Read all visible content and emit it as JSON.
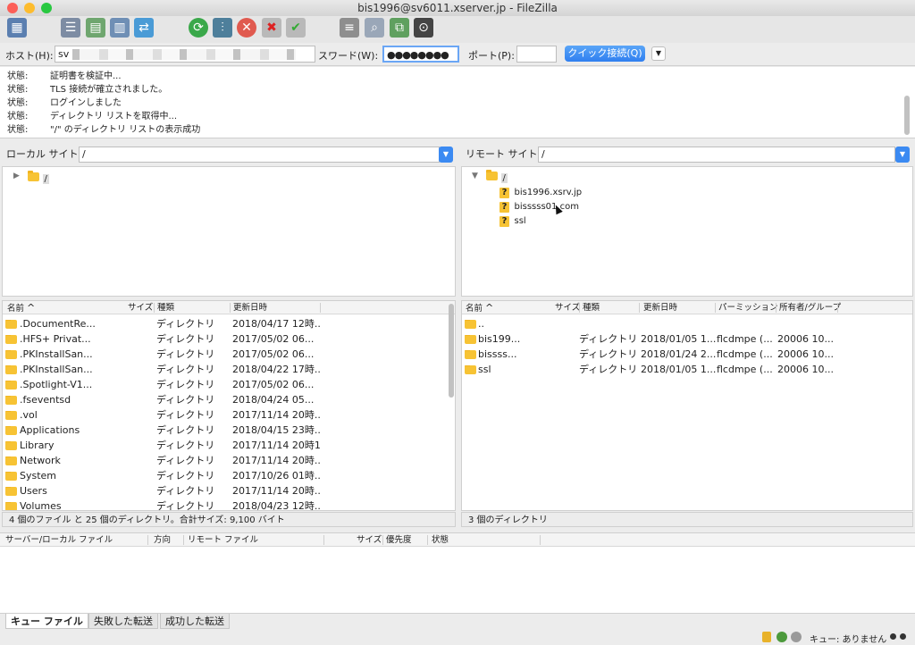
{
  "window": {
    "title": "bis1996@sv6011.xserver.jp - FileZilla"
  },
  "quickconnect": {
    "host_label": "ホスト(H):",
    "host_value": "sv",
    "password_label": "スワード(W):",
    "password_value": "●●●●●●●●",
    "port_label": "ポート(P):",
    "port_value": "",
    "connect_button": "クイック接続(Q)"
  },
  "log": [
    {
      "label": "状態:",
      "message": "証明書を検証中..."
    },
    {
      "label": "状態:",
      "message": "TLS 接続が確立されました。"
    },
    {
      "label": "状態:",
      "message": "ログインしました"
    },
    {
      "label": "状態:",
      "message": "ディレクトリ リストを取得中..."
    },
    {
      "label": "状態:",
      "message": "\"/\" のディレクトリ リストの表示成功"
    }
  ],
  "local": {
    "site_label": "ローカル サイト:",
    "path": "/",
    "tree_root": "/",
    "columns": {
      "name": "名前",
      "size": "サイズ",
      "type": "種類",
      "modified": "更新日時"
    },
    "files": [
      {
        "name": ".DocumentRe...",
        "type": "ディレクトリ",
        "modified": "2018/04/17 12時..."
      },
      {
        "name": ".HFS+ Privat...",
        "type": "ディレクトリ",
        "modified": "2017/05/02 06..."
      },
      {
        "name": ".PKInstallSan...",
        "type": "ディレクトリ",
        "modified": "2017/05/02 06..."
      },
      {
        "name": ".PKInstallSan...",
        "type": "ディレクトリ",
        "modified": "2018/04/22 17時..."
      },
      {
        "name": ".Spotlight-V1...",
        "type": "ディレクトリ",
        "modified": "2017/05/02 06..."
      },
      {
        "name": ".fseventsd",
        "type": "ディレクトリ",
        "modified": "2018/04/24 05..."
      },
      {
        "name": ".vol",
        "type": "ディレクトリ",
        "modified": "2017/11/14 20時..."
      },
      {
        "name": "Applications",
        "type": "ディレクトリ",
        "modified": "2018/04/15 23時..."
      },
      {
        "name": "Library",
        "type": "ディレクトリ",
        "modified": "2017/11/14 20時1..."
      },
      {
        "name": "Network",
        "type": "ディレクトリ",
        "modified": "2017/11/14 20時..."
      },
      {
        "name": "System",
        "type": "ディレクトリ",
        "modified": "2017/10/26 01時..."
      },
      {
        "name": "Users",
        "type": "ディレクトリ",
        "modified": "2017/11/14 20時..."
      },
      {
        "name": "Volumes",
        "type": "ディレクトリ",
        "modified": "2018/04/23 12時..."
      }
    ],
    "status": "4 個のファイル と 25 個のディレクトリ。合計サイズ: 9,100 バイト"
  },
  "remote": {
    "site_label": "リモート サイト:",
    "path": "/",
    "tree_root": "/",
    "tree_children": [
      "bis1996.xsrv.jp",
      "bisssss01.com",
      "ssl"
    ],
    "columns": {
      "name": "名前",
      "size": "サイズ",
      "type": "種類",
      "modified": "更新日時",
      "permission": "パーミッション",
      "owner": "所有者/グループ"
    },
    "files": [
      {
        "name": "..",
        "type": "",
        "modified": "",
        "permission": "",
        "owner": ""
      },
      {
        "name": "bis199...",
        "type": "ディレクトリ",
        "modified": "2018/01/05 1...",
        "permission": "flcdmpe (...",
        "owner": "20006 10..."
      },
      {
        "name": "bissss...",
        "type": "ディレクトリ",
        "modified": "2018/01/24 2...",
        "permission": "flcdmpe (...",
        "owner": "20006 10..."
      },
      {
        "name": "ssl",
        "type": "ディレクトリ",
        "modified": "2018/01/05 1...",
        "permission": "flcdmpe (...",
        "owner": "20006 10..."
      }
    ],
    "status": "3 個のディレクトリ"
  },
  "queue": {
    "columns": {
      "server_file": "サーバー/ローカル ファイル",
      "direction": "方向",
      "remote_file": "リモート ファイル",
      "size": "サイズ",
      "priority": "優先度",
      "status": "状態"
    },
    "tabs": [
      "キュー ファイル",
      "失敗した転送",
      "成功した転送"
    ],
    "status_text": "キュー: ありません"
  },
  "colors": {
    "accent": "#2f7ff0",
    "folder": "#f7c334"
  }
}
